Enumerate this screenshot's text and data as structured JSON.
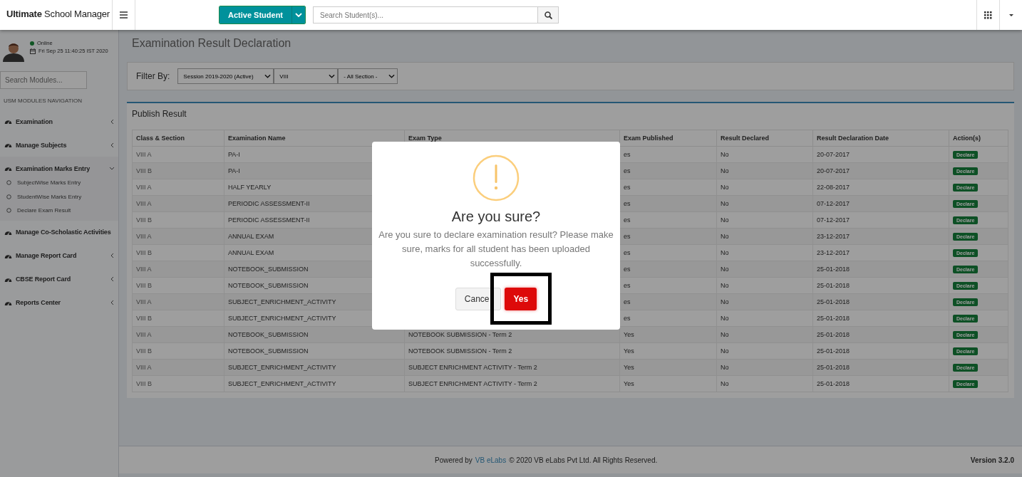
{
  "header": {
    "logo": "**Ultimate** School Manager",
    "student_filter": "Active Student",
    "search": {
      "placeholder": "Search Student(s)..."
    }
  },
  "sidebar": {
    "user": {
      "status": "Online",
      "datetime": "Fri Sep 25 11:40:25 IST 2020"
    },
    "search": {
      "placeholder": "Search Modules..."
    },
    "heading": "USM MODULES NAVIGATION",
    "items": [
      {
        "label": "Examination",
        "expanded": false
      },
      {
        "label": "Manage Subjects",
        "expanded": false
      },
      {
        "label": "Examination Marks Entry",
        "expanded": true,
        "children": [
          {
            "label": "SubjectWise Marks Entry"
          },
          {
            "label": "StudentWise Marks Entry"
          },
          {
            "label": "Declare Exam Result"
          }
        ]
      },
      {
        "label": "Manage Co-Scholastic Activities"
      },
      {
        "label": "Manage Report Card",
        "expanded": false
      },
      {
        "label": "CBSE Report Card",
        "expanded": false
      },
      {
        "label": "Reports Center",
        "expanded": false
      }
    ]
  },
  "page": {
    "title": "Examination Result Declaration",
    "filter": {
      "label": "Filter By:",
      "selects": [
        "Session 2019-2020 (Active)",
        "VIII",
        "- All Section -"
      ]
    },
    "panel": {
      "title": "Publish Result",
      "table": {
        "columns": [
          "Class & Section",
          "Examination Name",
          "Exam Type",
          "Exam Published",
          "Result Declared",
          "Result Declaration Date",
          "Action(s)"
        ],
        "rows": [
          {
            "class_section": "VIII A",
            "exam_name": "PA-I",
            "exam_published": "es",
            "result_declared": "No",
            "date": "20-07-2017",
            "action": "Declare"
          },
          {
            "class_section": "VIII B",
            "exam_name": "PA-I",
            "exam_published": "es",
            "result_declared": "No",
            "date": "20-07-2017",
            "action": "Declare"
          },
          {
            "class_section": "VIII A",
            "exam_name": "HALF YEARLY",
            "exam_published": "es",
            "result_declared": "No",
            "date": "22-08-2017",
            "action": "Declare"
          },
          {
            "class_section": "VIII A",
            "exam_name": "PERIODIC ASSESSMENT-II",
            "exam_published": "es",
            "result_declared": "No",
            "date": "07-12-2017",
            "action": "Declare"
          },
          {
            "class_section": "VIII B",
            "exam_name": "PERIODIC ASSESSMENT-II",
            "exam_published": "es",
            "result_declared": "No",
            "date": "07-12-2017",
            "action": "Declare"
          },
          {
            "class_section": "VIII A",
            "exam_name": "ANNUAL EXAM",
            "exam_published": "es",
            "result_declared": "No",
            "date": "23-12-2017",
            "action": "Declare"
          },
          {
            "class_section": "VIII B",
            "exam_name": "ANNUAL EXAM",
            "exam_published": "es",
            "result_declared": "No",
            "date": "23-12-2017",
            "action": "Declare"
          },
          {
            "class_section": "VIII A",
            "exam_name": "NOTEBOOK_SUBMISSION",
            "exam_published": "es",
            "result_declared": "No",
            "date": "25-01-2018",
            "action": "Declare"
          },
          {
            "class_section": "VIII B",
            "exam_name": "NOTEBOOK_SUBMISSION",
            "exam_published": "es",
            "result_declared": "No",
            "date": "25-01-2018",
            "action": "Declare"
          },
          {
            "class_section": "VIII A",
            "exam_name": "SUBJECT_ENRICHMENT_ACTIVITY",
            "exam_published": "es",
            "result_declared": "No",
            "date": "25-01-2018",
            "action": "Declare"
          },
          {
            "class_section": "VIII B",
            "exam_name": "SUBJECT_ENRICHMENT_ACTIVITY",
            "exam_published": "es",
            "result_declared": "No",
            "date": "25-01-2018",
            "action": "Declare"
          },
          {
            "class_section": "VIII A",
            "exam_name": "NOTEBOOK_SUBMISSION",
            "exam_type": "NOTEBOOK SUBMISSION - Term 2",
            "exam_published": "Yes",
            "result_declared": "No",
            "date": "25-01-2018",
            "action": "Declare"
          },
          {
            "class_section": "VIII B",
            "exam_name": "NOTEBOOK_SUBMISSION",
            "exam_type": "NOTEBOOK SUBMISSION - Term 2",
            "exam_published": "Yes",
            "result_declared": "No",
            "date": "25-01-2018",
            "action": "Declare"
          },
          {
            "class_section": "VIII A",
            "exam_name": "SUBJECT_ENRICHMENT_ACTIVITY",
            "exam_type": "SUBJECT ENRICHMENT ACTIVITY - Term 2",
            "exam_published": "Yes",
            "result_declared": "No",
            "date": "25-01-2018",
            "action": "Declare"
          },
          {
            "class_section": "VIII B",
            "exam_name": "SUBJECT_ENRICHMENT_ACTIVITY",
            "exam_type": "SUBJECT ENRICHMENT ACTIVITY - Term 2",
            "exam_published": "Yes",
            "result_declared": "No",
            "date": "25-01-2018",
            "action": "Declare"
          }
        ]
      }
    }
  },
  "dialog": {
    "title": "Are you sure?",
    "message": "Are you sure to declare examination result? Please make sure, marks for all student has been uploaded successfully.",
    "buttons": [
      {
        "label": "Cance",
        "kind": "cancel"
      },
      {
        "label": "Yes",
        "kind": "confirm",
        "highlighted": true
      }
    ]
  },
  "footer": {
    "powered_by": "Powered by",
    "link": "VB eLabs",
    "copyright": "© 2020 VB eLabs Pvt Ltd. All Rights Reserved.",
    "version": "Version 3.2.0"
  }
}
